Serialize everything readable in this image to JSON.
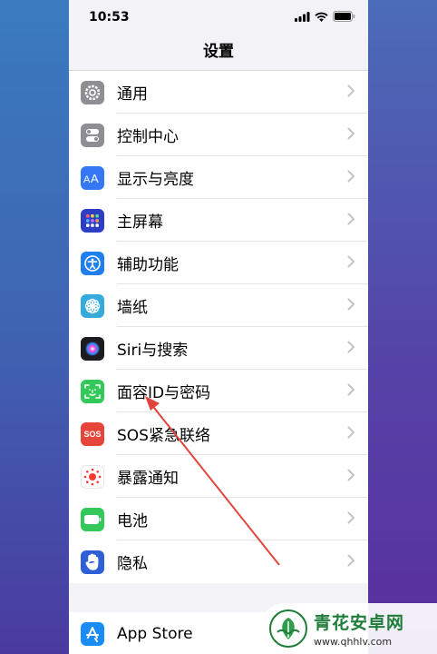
{
  "status_bar": {
    "time": "10:53"
  },
  "nav": {
    "title": "设置"
  },
  "items": [
    {
      "label": "通用",
      "icon": "gear-icon",
      "color": "#8e8e93"
    },
    {
      "label": "控制中心",
      "icon": "toggles-icon",
      "color": "#8e8e93"
    },
    {
      "label": "显示与亮度",
      "icon": "text-size-icon",
      "color": "#3478f6"
    },
    {
      "label": "主屏幕",
      "icon": "home-grid-icon",
      "color": "#2e3ec4"
    },
    {
      "label": "辅助功能",
      "icon": "accessibility-icon",
      "color": "#1f7ef0"
    },
    {
      "label": "墙纸",
      "icon": "flower-icon",
      "color": "#37aadc"
    },
    {
      "label": "Siri与搜索",
      "icon": "siri-icon",
      "color": "#1c1c1e"
    },
    {
      "label": "面容ID与密码",
      "icon": "face-id-icon",
      "color": "#34c759"
    },
    {
      "label": "SOS紧急联络",
      "icon": "sos-icon",
      "color": "#e5453a",
      "icon_text": "SOS"
    },
    {
      "label": "暴露通知",
      "icon": "exposure-icon",
      "color": "#ffffff"
    },
    {
      "label": "电池",
      "icon": "battery-icon",
      "color": "#34c759"
    },
    {
      "label": "隐私",
      "icon": "hand-icon",
      "color": "#2f5fd6"
    }
  ],
  "app_store": {
    "label": "App Store",
    "icon": "app-store-icon",
    "color": "#1a8cf5"
  },
  "annotation": {
    "color": "#e0443a"
  },
  "watermark": {
    "title": "青花安卓网",
    "url": "www.qhhlv.com",
    "color": "#1f7d3a"
  }
}
